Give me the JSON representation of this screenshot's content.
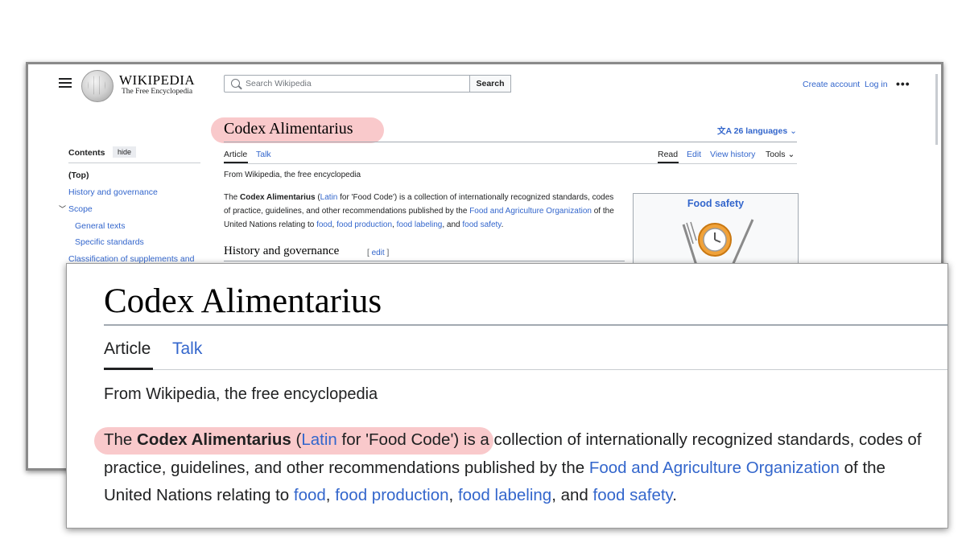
{
  "header": {
    "wordmark": "WIKIPEDIA",
    "tagline": "The Free Encyclopedia",
    "search_placeholder": "Search Wikipedia",
    "search_button": "Search",
    "create_account": "Create account",
    "log_in": "Log in",
    "more": "•••"
  },
  "toc": {
    "heading": "Contents",
    "hide": "hide",
    "items": [
      "(Top)",
      "History and governance",
      "Scope",
      "General texts",
      "Specific standards",
      "Classification of supplements and"
    ]
  },
  "article": {
    "title": "Codex Alimentarius",
    "languages": "26 languages",
    "tabs": {
      "article": "Article",
      "talk": "Talk",
      "read": "Read",
      "edit": "Edit",
      "history": "View history",
      "tools": "Tools"
    },
    "from": "From Wikipedia, the free encyclopedia",
    "lead": {
      "the": "The ",
      "bold": "Codex Alimentarius",
      "paren_open": " (",
      "latin": "Latin",
      "for_text": " for 'Food Code') is a collection of internationally recognized standards, codes of practice, guidelines, and other recommendations published by the ",
      "fao": "Food and Agriculture Organization",
      "of_text": " of the United Nations relating to ",
      "food": "food",
      "food_production": "food production",
      "food_labeling": "food labeling",
      "and_text": ", and ",
      "food_safety": "food safety",
      "comma": ", ",
      "period": "."
    },
    "section": {
      "title": "History and governance",
      "edit": "edit"
    },
    "infobox_title": "Food safety"
  },
  "colors": {
    "link": "#3366cc",
    "highlight": "#f9c9cb",
    "text": "#202122"
  }
}
